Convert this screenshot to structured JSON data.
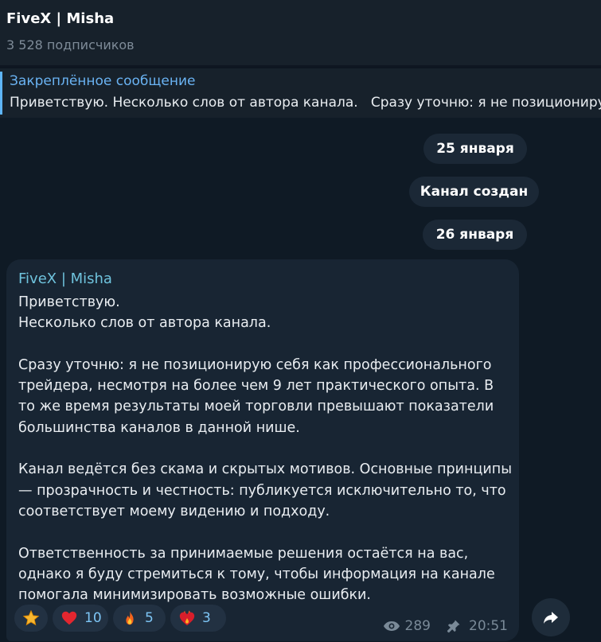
{
  "header": {
    "title": "FiveX | Misha",
    "subscribers": "3 528 подписчиков"
  },
  "pinned": {
    "title": "Закреплённое сообщение",
    "text": "Приветствую. Несколько слов от автора канала.   Сразу уточню: я не позиционирую себя как профессионального трейдера"
  },
  "service": {
    "date1": "25 января",
    "created": "Канал создан",
    "date2": "26 января"
  },
  "message": {
    "author": "FiveX | Misha",
    "text": "Приветствую.\nНесколько слов от автора канала.\n\nСразу уточню: я не позиционирую себя как профессионального трейдера, несмотря на более чем 9 лет практического опыта. В то же время результаты моей торговли превышают показатели большинства каналов в данной нише.\n\nКанал ведётся без скама и скрытых мотивов. Основные принципы — прозрачность и честность: публикуется исключительно то, что соответствует моему видению и подходу.\n\nОтветственность за принимаемые решения остаётся на вас, однако я буду стремиться к тому, чтобы информация на канале помогала минимизировать возможные ошибки.",
    "reactions": [
      {
        "icon": "star-icon",
        "count": ""
      },
      {
        "icon": "heart-icon",
        "count": "10"
      },
      {
        "icon": "fire-icon",
        "count": "5"
      },
      {
        "icon": "heart-on-fire-icon",
        "count": "3"
      }
    ],
    "views": "289",
    "time": "20:51"
  },
  "colors": {
    "accent": "#6ab3f3",
    "author": "#6fc3dd",
    "reaction_count": "#7ec6f6"
  }
}
